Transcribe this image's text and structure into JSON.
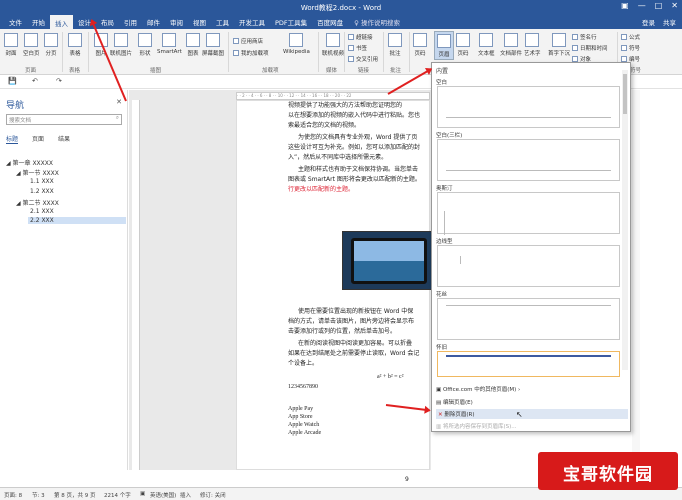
{
  "titlebar": {
    "title": "Word教程2.docx - Word",
    "min": "—",
    "max": "□",
    "close": "✕",
    "ribbon_opts": "▣"
  },
  "tabs": {
    "items": [
      "文件",
      "开始",
      "插入",
      "设计",
      "布局",
      "引用",
      "邮件",
      "审阅",
      "视图",
      "工具",
      "开发工具",
      "PDF工具集",
      "百度网盘"
    ],
    "active_index": 2,
    "search": "操作说明搜索",
    "login": "登录",
    "share": "共享"
  },
  "ribbon": {
    "pages": {
      "cover": "封面",
      "blank": "空白页",
      "break": "分页",
      "group": "页面"
    },
    "table": {
      "label": "表格",
      "group": "表格"
    },
    "illustrations": {
      "picture": "图片",
      "online": "联机图片",
      "shape": "形状",
      "smartart": "SmartArt",
      "chart": "图表",
      "screenshot": "屏幕截图",
      "group": "插图"
    },
    "addins": {
      "store": "应用商店",
      "my": "我的加载项",
      "wiki": "Wikipedia",
      "group": "加载项"
    },
    "media": {
      "video": "联机视频",
      "group": "媒体"
    },
    "links": {
      "link": "超链接",
      "bookmark": "书签",
      "crossref": "交叉引用",
      "group": "链接"
    },
    "comments": {
      "comment": "批注",
      "group": "批注"
    },
    "hf": {
      "header": "页眉",
      "footer": "页码",
      "group": "页眉和页脚"
    },
    "text": {
      "textbox": "文本框",
      "docparts": "文档部件",
      "wordart": "艺术字",
      "dropcap": "首字下沉",
      "sigline": "签名行",
      "datetime": "日期和时间",
      "object": "对象",
      "group": "文本"
    },
    "symbols": {
      "equation": "公式",
      "symbol": "符号",
      "number": "编号",
      "group": "符号"
    }
  },
  "qat": {
    "save": "💾",
    "undo": "↶",
    "redo": "↷"
  },
  "nav": {
    "title": "导航",
    "close": "✕",
    "search_placeholder": "搜索文档",
    "tabs": [
      "标题",
      "页面",
      "结果"
    ],
    "outline": [
      "第一章 XXXXX",
      "第一节 XXXX",
      "1.1 XXX",
      "1.2 XXX",
      "第二节 XXXX",
      "2.1 XXX",
      "2.2 XXX"
    ],
    "selected_index": 6
  },
  "doc": {
    "lines": [
      "视频提供了功能强大的方法帮助您证明您的",
      "以在想要添加的视频的嵌入代码中进行粘贴。您也",
      "索最适合您的文档的视频。",
      "为使您的文档具有专业外观，Word 提供了页",
      "这些设计可互为补充。例如，您可以添加匹配的封",
      "入”，然后从不同库中选择所需元素。",
      "主题和样式也有助于文档保持协调。当您单击",
      "图表或 SmartArt 图形将会更改以匹配新的主题。"
    ],
    "red_line": "行更改以匹配新的主题。",
    "lines2": [
      "使用在需要位置出现的新按钮在 Word 中保",
      "档的方式，请单击该图片，图片旁边将会显示布",
      "击要添加行或列的位置，然后单击加号。",
      "在新的阅读视图中阅读更加容易。可以折叠",
      "如果在达到结尾处之前需要停止读取，Word 会记",
      "个设备上。"
    ],
    "formula": "a² + b² = c²",
    "number": "1234567890",
    "apple": [
      "Apple Pay",
      "App Store",
      "Apple Watch",
      "Apple Arcade"
    ],
    "page_num": "9"
  },
  "dropdown": {
    "head": "内置",
    "items": [
      {
        "label": "空白",
        "highlight": false
      },
      {
        "label": "空白(三栏)",
        "highlight": false
      },
      {
        "label": "奥斯汀",
        "highlight": false
      },
      {
        "label": "边线型",
        "highlight": false
      },
      {
        "label": "花丝",
        "highlight": false
      },
      {
        "label": "怀旧",
        "highlight": true
      }
    ],
    "menu": [
      "Office.com 中的其他页眉(M)",
      "编辑页眉(E)",
      "删除页眉(R)",
      "将所选内容保存到页眉库(S)..."
    ],
    "hover_index": 2,
    "disabled_index": 3
  },
  "status": {
    "page": "页面: 8",
    "section": "节: 3",
    "page_of": "第 8 页，共 9 页",
    "words": "2214 个字",
    "lang": "英语(美国)",
    "insert": "插入",
    "track": "修订: 关闭"
  },
  "watermark": "宝哥软件园"
}
